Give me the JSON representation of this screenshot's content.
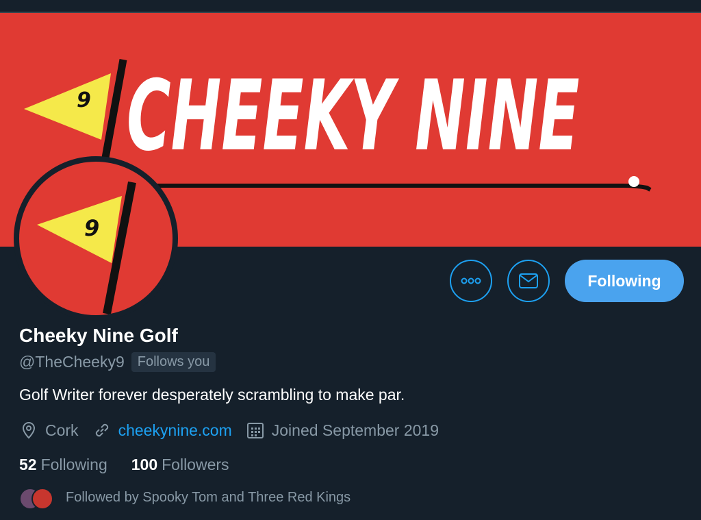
{
  "banner": {
    "title": "CHEEKY NINE",
    "flag_number": "9",
    "colors": {
      "background": "#e03a33",
      "flag": "#f5e94a",
      "pole": "#111111"
    }
  },
  "avatar": {
    "flag_number": "9"
  },
  "actions": {
    "more_icon": "more-icon",
    "message_icon": "mail-icon",
    "follow_label": "Following"
  },
  "profile": {
    "name": "Cheeky Nine Golf",
    "handle": "@TheCheeky9",
    "follows_you": "Follows you",
    "bio": "Golf Writer forever desperately scrambling to make par.",
    "location": "Cork",
    "website": "cheekynine.com",
    "joined": "Joined September 2019"
  },
  "stats": {
    "following_count": "52",
    "following_label": "Following",
    "followers_count": "100",
    "followers_label": "Followers"
  },
  "followed_by": {
    "text": "Followed by Spooky Tom and Three Red Kings"
  },
  "colors": {
    "accent": "#1da1f2",
    "background": "#15202b",
    "muted_text": "#8899a6"
  }
}
